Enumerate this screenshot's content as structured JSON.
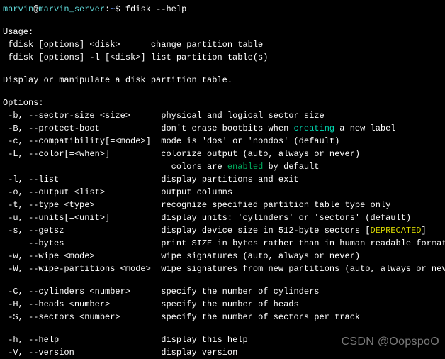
{
  "prompt": {
    "user": "marvin",
    "at": "@",
    "host": "marvin_server",
    "colon": ":",
    "path": "~",
    "dollar": "$ ",
    "command": "fdisk --help"
  },
  "usage": {
    "header": "Usage:",
    "line1": " fdisk [options] <disk>      change partition table",
    "line2": " fdisk [options] -l [<disk>] list partition table(s)"
  },
  "description": "Display or manipulate a disk partition table.",
  "options_header": "Options:",
  "rows": {
    "r1f": " -b, --sector-size <size>      ",
    "r1d": "physical and logical sector size",
    "r2f": " -B, --protect-boot            ",
    "r2d1": "don't erase bootbits when ",
    "r2hl": "creating",
    "r2d2": " a new label",
    "r3f": " -c, --compatibility[=<mode>]  ",
    "r3d": "mode is 'dos' or 'nondos' (default)",
    "r4f": " -L, --color[=<when>]          ",
    "r4d": "colorize output (auto, always or never)",
    "r5f": "                                 ",
    "r5d1": "colors are ",
    "r5hl": "enabled",
    "r5d2": " by default",
    "r6f": " -l, --list                    ",
    "r6d": "display partitions and exit",
    "r7f": " -o, --output <list>           ",
    "r7d": "output columns",
    "r8f": " -t, --type <type>             ",
    "r8d": "recognize specified partition table type only",
    "r9f": " -u, --units[=<unit>]          ",
    "r9d": "display units: 'cylinders' or 'sectors' (default)",
    "r10f": " -s, --getsz                   ",
    "r10d1": "display device size in 512-byte sectors [",
    "r10hl": "DEPRECATED",
    "r10d2": "]",
    "r11f": "     --bytes                   ",
    "r11d": "print SIZE in bytes rather than in human readable format",
    "r12f": " -w, --wipe <mode>             ",
    "r12d": "wipe signatures (auto, always or never)",
    "r13f": " -W, --wipe-partitions <mode>  ",
    "r13d": "wipe signatures from new partitions (auto, always or never)",
    "r14f": " -C, --cylinders <number>      ",
    "r14d": "specify the number of cylinders",
    "r15f": " -H, --heads <number>          ",
    "r15d": "specify the number of heads",
    "r16f": " -S, --sectors <number>        ",
    "r16d": "specify the number of sectors per track",
    "r17f": " -h, --help                    ",
    "r17d": "display this help",
    "r18f": " -V, --version                 ",
    "r18d": "display version"
  },
  "watermark": "CSDN @OopspoO"
}
